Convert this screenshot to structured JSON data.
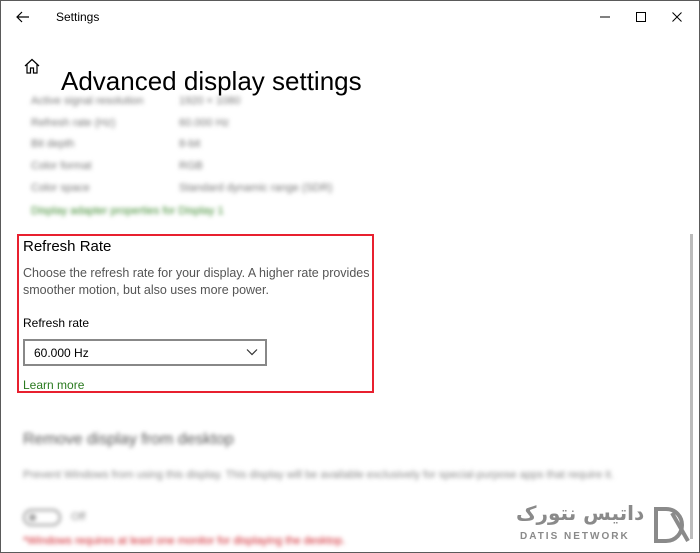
{
  "window": {
    "app_title": "Settings"
  },
  "page": {
    "title": "Advanced display settings"
  },
  "display_info": [
    {
      "label": "Active signal resolution",
      "value": "1920 × 1080"
    },
    {
      "label": "Refresh rate (Hz)",
      "value": "60.000 Hz"
    },
    {
      "label": "Bit depth",
      "value": "8-bit"
    },
    {
      "label": "Color format",
      "value": "RGB"
    },
    {
      "label": "Color space",
      "value": "Standard dynamic range (SDR)"
    }
  ],
  "adapter_link": "Display adapter properties for Display 1",
  "refresh_rate": {
    "heading": "Refresh Rate",
    "description": "Choose the refresh rate for your display. A higher rate provides smoother motion, but also uses more power.",
    "field_label": "Refresh rate",
    "selected_value": "60.000 Hz",
    "learn_more": "Learn more"
  },
  "remove_display": {
    "heading": "Remove display from desktop",
    "description": "Prevent Windows from using this display. This display will be available exclusively for special-purpose apps that require it.",
    "toggle_state": "Off",
    "warning": "*Windows requires at least one monitor for displaying the desktop."
  },
  "watermark": {
    "arabic": "داتیس نتورک",
    "latin": "DATIS NETWORK"
  },
  "colors": {
    "accent_link": "#2a7a1f",
    "highlight_border": "#e8202f",
    "warning": "#d0202a"
  },
  "icons": [
    "back-arrow-icon",
    "minimize-icon",
    "maximize-icon",
    "close-icon",
    "home-icon",
    "chevron-down-icon"
  ]
}
